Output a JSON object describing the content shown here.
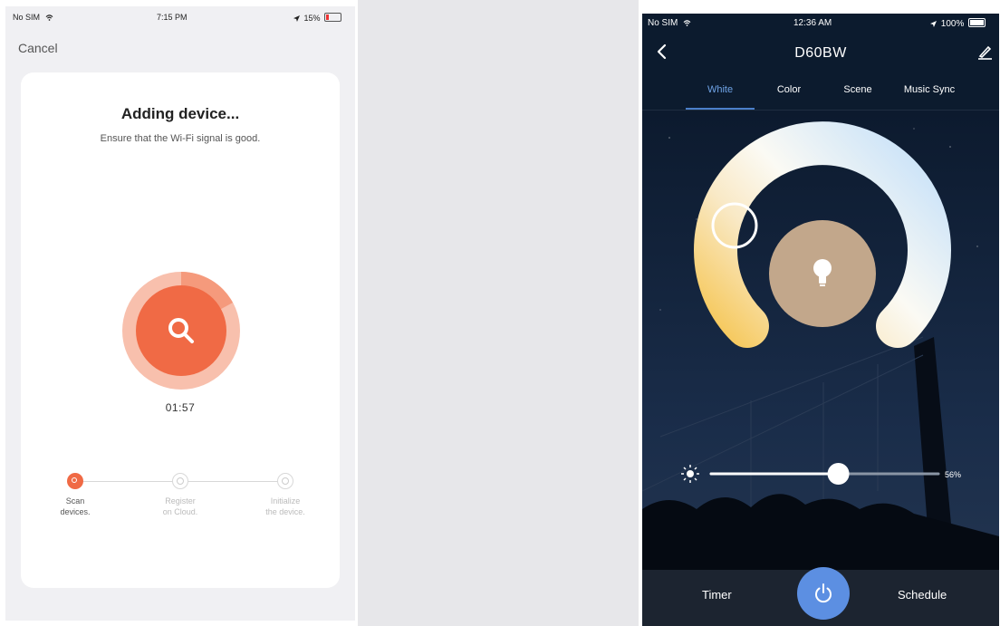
{
  "left_phone": {
    "status_bar": {
      "carrier": "No SIM",
      "time": "7:15 PM",
      "battery": "15%"
    },
    "cancel_label": "Cancel",
    "title": "Adding device...",
    "subtitle": "Ensure that the Wi-Fi signal is good.",
    "timer": "01:57",
    "steps": [
      {
        "label": "Scan\ndevices.",
        "state": "active"
      },
      {
        "label": "Register\non Cloud.",
        "state": "pending"
      },
      {
        "label": "Initialize\nthe device.",
        "state": "pending"
      }
    ],
    "accent_color": "#f06a45"
  },
  "right_phone": {
    "status_bar": {
      "carrier": "No SIM",
      "time": "12:36 AM",
      "battery": "100%"
    },
    "title": "D60BW",
    "tabs": [
      {
        "label": "White",
        "active": true
      },
      {
        "label": "Color",
        "active": false
      },
      {
        "label": "Scene",
        "active": false
      },
      {
        "label": "Music Sync",
        "active": false
      }
    ],
    "brightness": {
      "value": 0.56,
      "label": "56%"
    },
    "bottom": {
      "timer_label": "Timer",
      "schedule_label": "Schedule"
    },
    "icons": [
      "back-icon",
      "edit-icon",
      "bulb-icon",
      "sun-icon",
      "power-icon"
    ],
    "accent_color": "#5c8fe2"
  }
}
